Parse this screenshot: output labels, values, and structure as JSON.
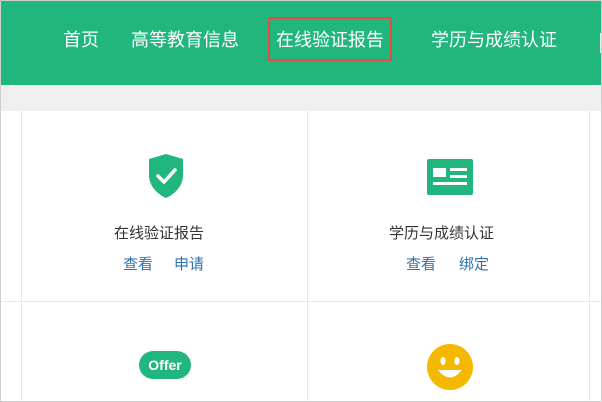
{
  "nav": {
    "items": [
      {
        "label": "首页"
      },
      {
        "label": "高等教育信息"
      },
      {
        "label": "在线验证报告"
      },
      {
        "label": "学历与成绩认证"
      }
    ]
  },
  "cards": {
    "online_report": {
      "title": "在线验证报告",
      "link_view": "查看",
      "link_apply": "申请"
    },
    "degree_cert": {
      "title": "学历与成绩认证",
      "link_view": "查看",
      "link_bind": "绑定"
    },
    "offer": {
      "badge": "Offer"
    }
  },
  "colors": {
    "brand_green": "#22b67f",
    "highlight_red": "#e84a3f",
    "link_blue": "#2e6fb3",
    "smile_yellow": "#f5b800"
  }
}
